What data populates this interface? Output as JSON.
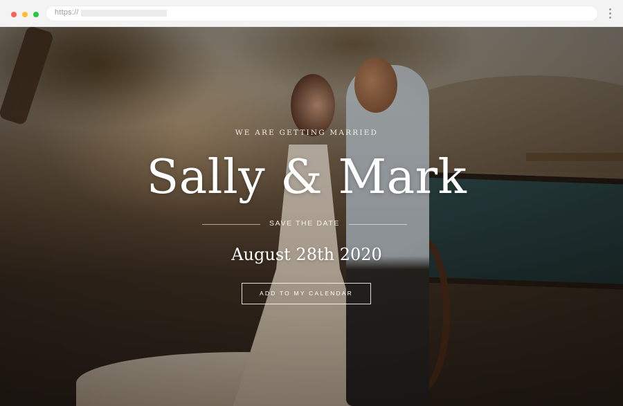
{
  "browser": {
    "url_scheme": "https://",
    "colors": {
      "close": "#ff5f57",
      "minimize": "#febc2e",
      "maximize": "#28c840"
    },
    "icons": [
      "close-dot-icon",
      "minimize-dot-icon",
      "maximize-dot-icon",
      "more-menu-icon"
    ]
  },
  "hero": {
    "eyebrow": "WE ARE GETTING MARRIED",
    "names": "Sally & Mark",
    "save_the_date": "SAVE THE DATE",
    "date": "August 28th 2020",
    "cta_label": "ADD TO MY CALENDAR",
    "text_color": "#ffffff"
  }
}
